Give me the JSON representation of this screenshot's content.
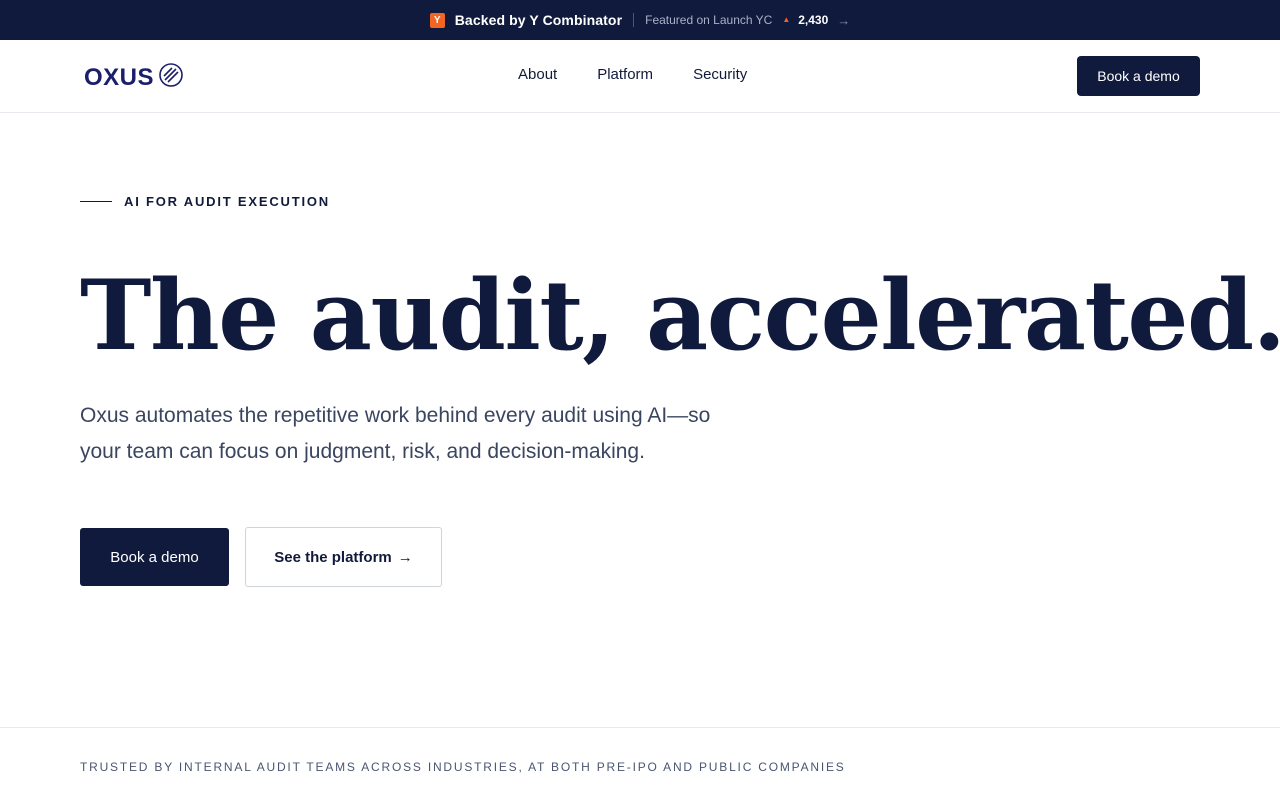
{
  "announcement": {
    "yc_badge": "Y",
    "backed_label": "Backed by Y Combinator",
    "featured_label": "Featured on Launch YC",
    "upvote_symbol": "▲",
    "upvote_count": "2,430",
    "arrow": "→"
  },
  "navbar": {
    "logo_text": "OXUS",
    "links": [
      {
        "label": "About"
      },
      {
        "label": "Platform"
      },
      {
        "label": "Security"
      }
    ],
    "cta_label": "Book a demo"
  },
  "hero": {
    "eyebrow": "AI FOR AUDIT EXECUTION",
    "headline": "The audit, accelerated.",
    "subhead_line1": "Oxus automates the repetitive work behind every audit using AI—so",
    "subhead_line2": "your team can focus on judgment, risk, and decision-making.",
    "primary_cta": "Book a demo",
    "secondary_cta": "See the platform",
    "secondary_arrow": "→"
  },
  "trusted": {
    "text": "TRUSTED BY INTERNAL AUDIT TEAMS ACROSS INDUSTRIES, AT BOTH PRE-IPO AND PUBLIC COMPANIES"
  },
  "colors": {
    "navy": "#0f1a3c",
    "yc_orange": "#f26522",
    "logo_indigo": "#1b1f6b"
  },
  "icons": {
    "yc": "y-combinator-icon",
    "upvote": "upvote-triangle-icon",
    "logo_mark": "striped-circle-logo-icon"
  }
}
